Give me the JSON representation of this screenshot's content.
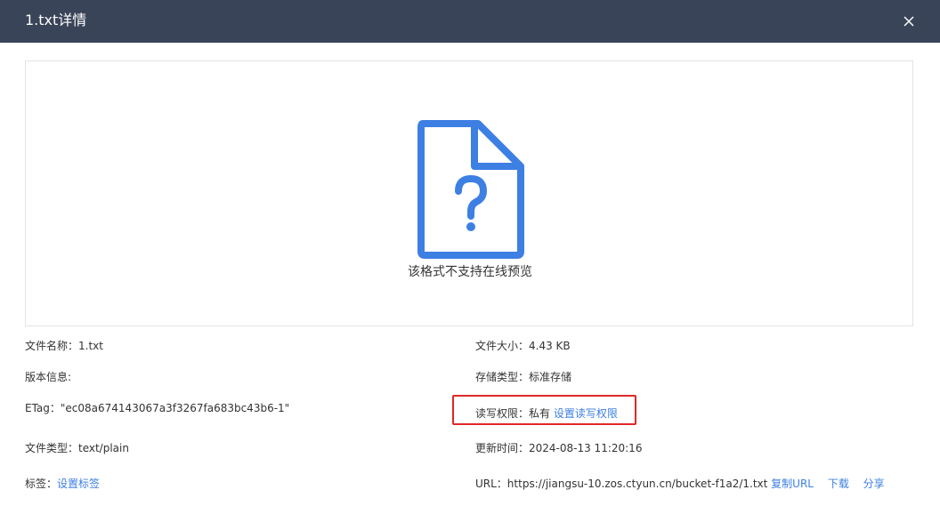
{
  "header": {
    "title": "1.txt详情",
    "close_label": "×"
  },
  "preview": {
    "icon": "file-question-icon",
    "icon_color": "#3d7fe3",
    "message": "该格式不支持在线预览"
  },
  "details": {
    "file_name": "文件名称：1.txt",
    "version_info": "版本信息:",
    "etag": "ETag：\"ec08a674143067a3f3267fa683bc43b6-1\"",
    "file_type": "文件类型：text/plain",
    "tags_label": "标签：",
    "tags_link": "设置标签",
    "file_size": "文件大小：4.43 KB",
    "storage_type": "存储类型：标准存储",
    "acl_label": "读写权限：私有",
    "acl_link": "设置读写权限",
    "updated_time": "更新时间：2024-08-13 11:20:16",
    "url_label": "URL：https://jiangsu-10.zos.ctyun.cn/bucket-f1a2/1.txt",
    "copy_url": "复制URL",
    "download": "下载",
    "share": "分享"
  },
  "colors": {
    "header_bg": "#3a4458",
    "link": "#3d7fe3",
    "highlight_border": "#e02828"
  }
}
